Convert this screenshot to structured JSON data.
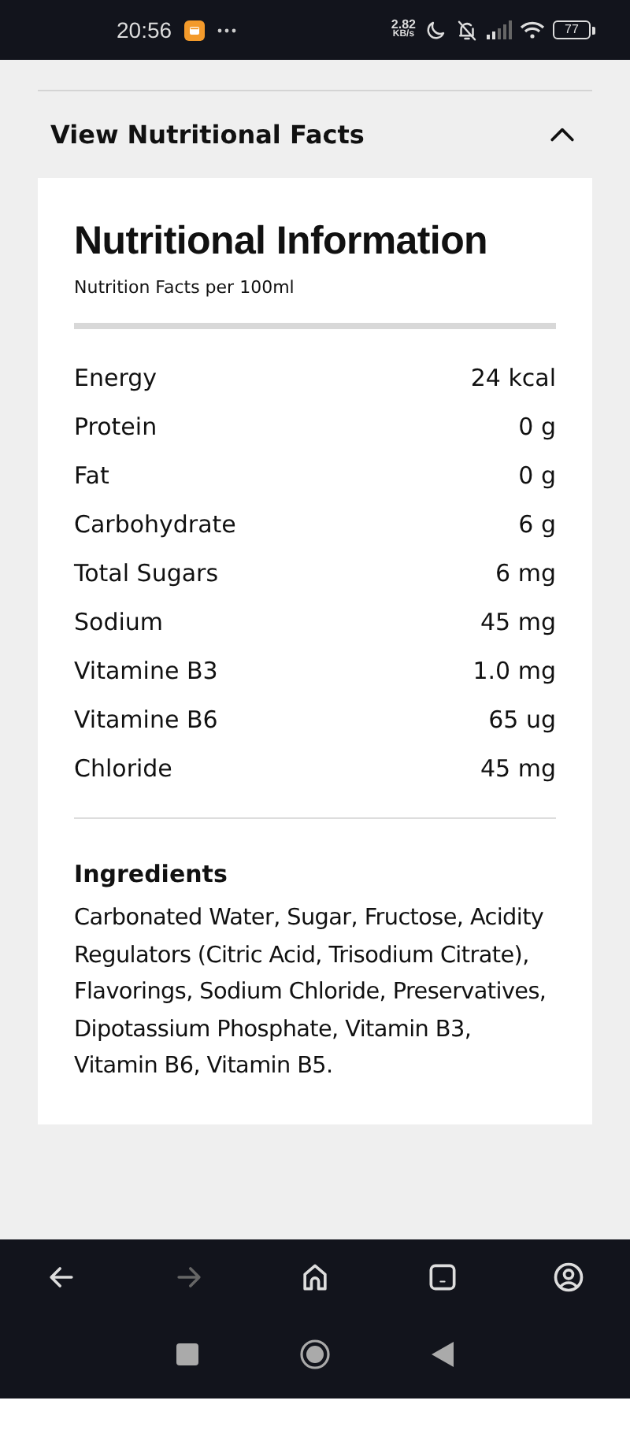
{
  "status_bar": {
    "time": "20:56",
    "net_speed": "2.82",
    "net_unit": "KB/s",
    "battery": "77"
  },
  "section": {
    "title": "View Nutritional Facts",
    "expanded": true
  },
  "card": {
    "title": "Nutritional Information",
    "subtitle": "Nutrition Facts per 100ml",
    "nutrients": [
      {
        "name": "Energy",
        "value": "24 kcal"
      },
      {
        "name": "Protein",
        "value": "0 g"
      },
      {
        "name": "Fat",
        "value": "0 g"
      },
      {
        "name": "Carbohydrate",
        "value": "6 g"
      },
      {
        "name": "Total Sugars",
        "value": "6 mg"
      },
      {
        "name": "Sodium",
        "value": "45 mg"
      },
      {
        "name": "Vitamine B3",
        "value": "1.0 mg"
      },
      {
        "name": "Vitamine B6",
        "value": "65 ug"
      },
      {
        "name": "Chloride",
        "value": "45 mg"
      }
    ],
    "ingredients_title": "Ingredients",
    "ingredients_text": "Carbonated Water, Sugar, Fructose, Acidity Regulators (Citric Acid, Trisodium Citrate), Flavorings, Sodium Chloride, Preservatives, Dipotassium Phosphate, Vitamin B3, Vitamin B6, Vitamin B5."
  },
  "browser_toolbar": [
    {
      "kind": "back",
      "disabled": false
    },
    {
      "kind": "forward",
      "disabled": true
    },
    {
      "kind": "home",
      "disabled": false
    },
    {
      "kind": "tabs",
      "disabled": false
    },
    {
      "kind": "account",
      "disabled": false
    }
  ],
  "system_nav": [
    {
      "kind": "recents"
    },
    {
      "kind": "home"
    },
    {
      "kind": "back"
    }
  ]
}
